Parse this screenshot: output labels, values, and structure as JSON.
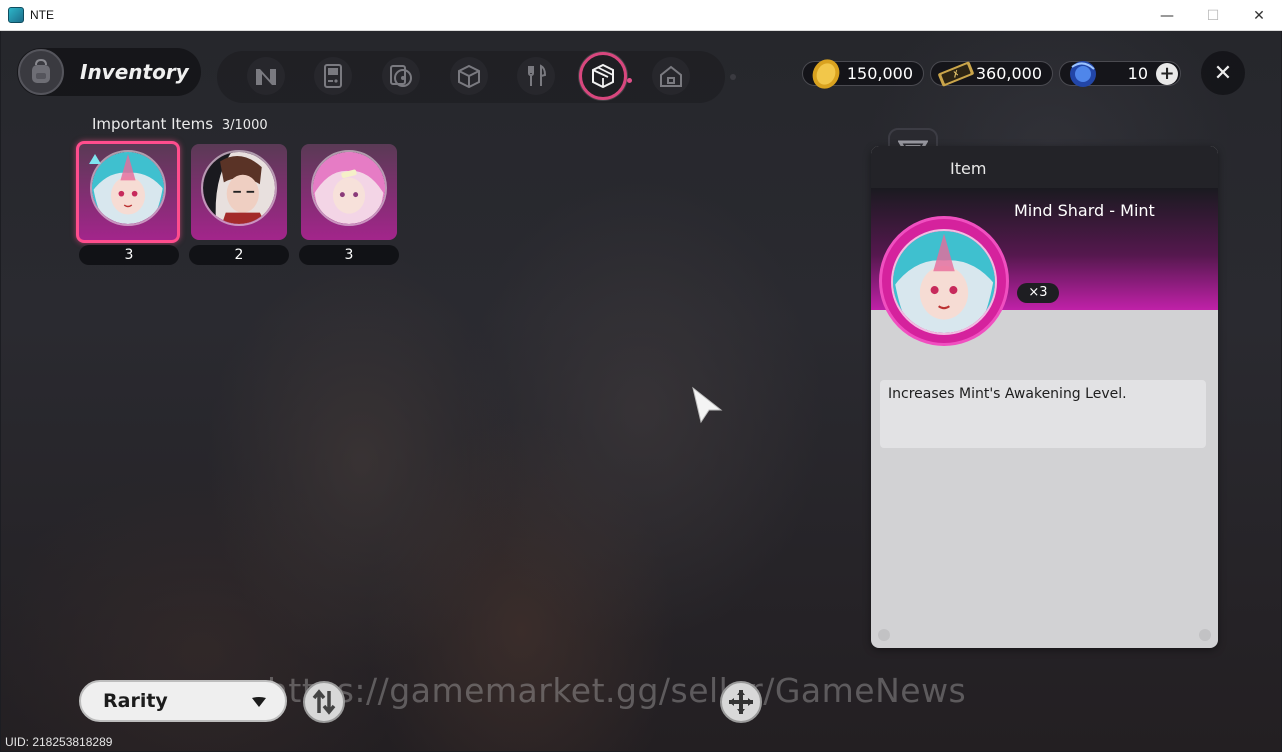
{
  "window": {
    "title": "NTE",
    "minimize": "—",
    "maximize": "☐",
    "close": "✕"
  },
  "header": {
    "title": "Inventory"
  },
  "tabs": [
    {
      "icon": "n-logo-icon"
    },
    {
      "icon": "gameboy-icon"
    },
    {
      "icon": "disc-icon"
    },
    {
      "icon": "box-icon"
    },
    {
      "icon": "cutlery-icon"
    },
    {
      "icon": "cube-gem-icon",
      "active": true
    },
    {
      "icon": "house-icon"
    }
  ],
  "currency": {
    "gold": "150,000",
    "ticket": "360,000",
    "crystal": "10",
    "add_symbol": "+"
  },
  "close_button": "✕",
  "section": {
    "title": "Important Items",
    "count": "3/1000"
  },
  "items": [
    {
      "count": "3",
      "selected": true
    },
    {
      "count": "2"
    },
    {
      "count": "3"
    }
  ],
  "detail": {
    "header_label": "Item",
    "name": "Mind Shard - Mint",
    "quantity": "×3",
    "description": "Increases Mint's Awakening Level."
  },
  "bottom": {
    "sort_label": "Rarity"
  },
  "watermark": "https://gamemarket.gg/seller/GameNews",
  "uid": "UID:  218253818289",
  "colors": {
    "accent": "#d8477e",
    "rarity_magenta": "#c021a8",
    "card_bg": "#a3258b"
  }
}
